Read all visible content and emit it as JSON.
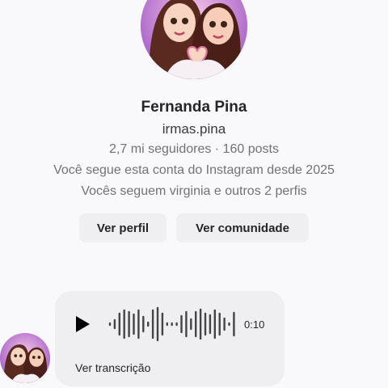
{
  "profile": {
    "name": "Fernanda Pina",
    "username": "irmas.pina",
    "stats": "2,7 mi seguidores · 160 posts",
    "follow_since": "Você segue esta conta do Instagram desde 2025",
    "mutual": "Vocês seguem virginia e outros 2 perfis"
  },
  "actions": {
    "view_profile": "Ver perfil",
    "view_community": "Ver comunidade"
  },
  "audio_message": {
    "duration": "0:10",
    "transcript_link": "Ver transcrição",
    "play_icon": "play-icon"
  },
  "colors": {
    "avatar_bg": "#b56fd0",
    "bubble_bg": "#efeef1",
    "button_bg": "#efeef1"
  }
}
